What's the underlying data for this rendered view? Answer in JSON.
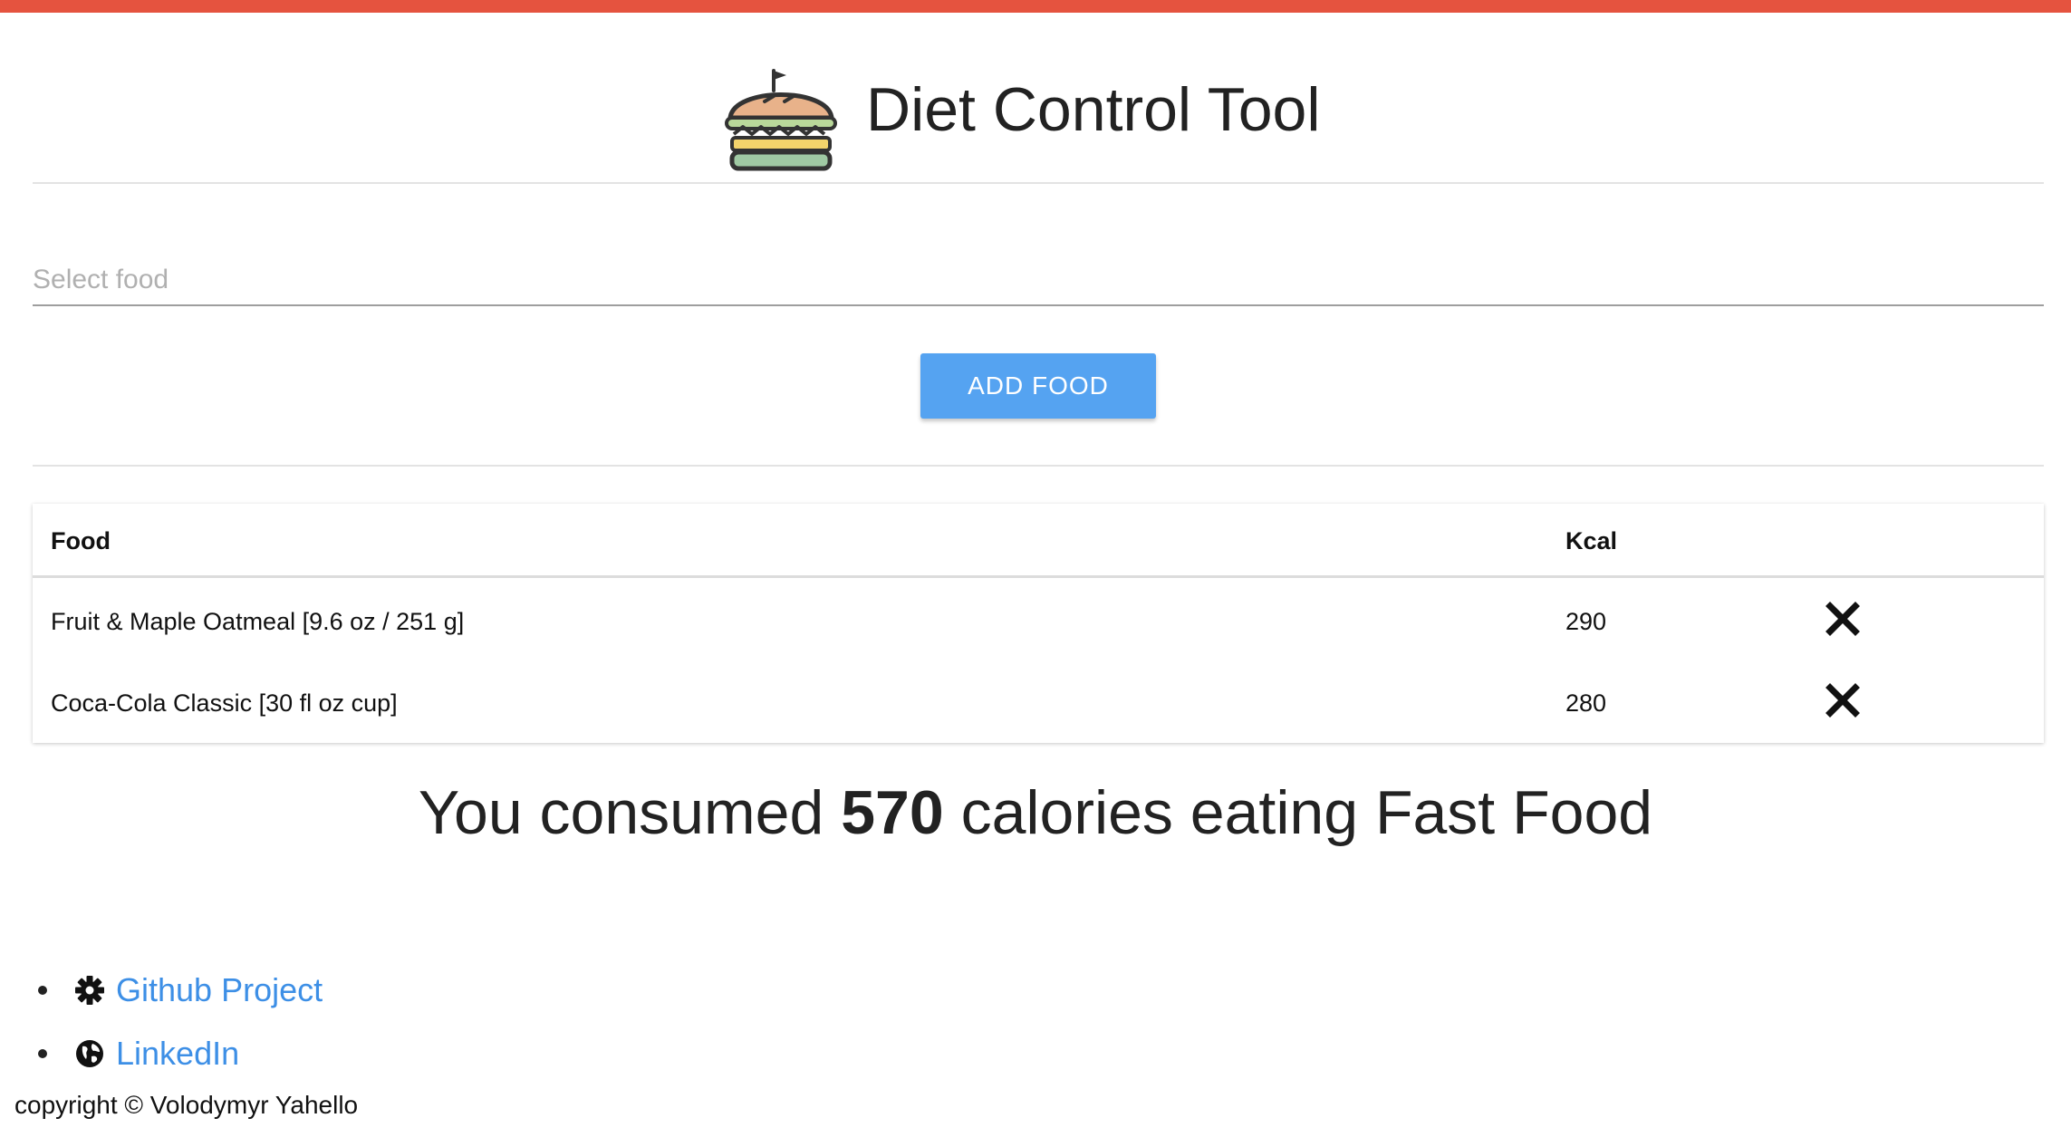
{
  "header": {
    "title": "Diet Control Tool",
    "logo_icon": "burger-icon"
  },
  "search": {
    "placeholder": "Select food",
    "value": ""
  },
  "actions": {
    "add_label": "ADD FOOD"
  },
  "table": {
    "columns": [
      "Food",
      "Kcal"
    ],
    "rows": [
      {
        "food": "Fruit & Maple Oatmeal [9.6 oz / 251 g]",
        "kcal": "290",
        "delete_icon": "close-icon"
      },
      {
        "food": "Coca-Cola Classic [30 fl oz cup]",
        "kcal": "280",
        "delete_icon": "close-icon"
      }
    ]
  },
  "summary": {
    "prefix": "You consumed",
    "total": "570",
    "suffix": "calories eating Fast Food"
  },
  "footer": {
    "links": [
      {
        "label": "Github Project",
        "icon": "gear-icon"
      },
      {
        "label": "LinkedIn",
        "icon": "globe-icon"
      }
    ],
    "copyright": "copyright © Volodymyr Yahello"
  },
  "colors": {
    "top_bar": "#e5533f",
    "button": "#55a3f1",
    "link": "#3d8fe6"
  }
}
